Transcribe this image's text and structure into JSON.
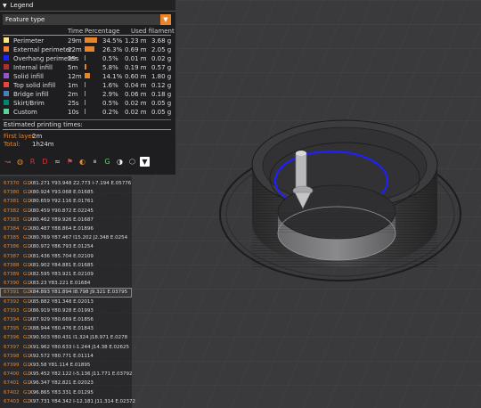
{
  "legend": {
    "header": "Legend",
    "selector_value": "Feature type",
    "columns": {
      "time": "Time",
      "percentage": "Percentage",
      "used_filament": "Used filament"
    },
    "features": [
      {
        "name": "Perimeter",
        "time": "29m",
        "pct": "34.5%",
        "len": "1.23 m",
        "wt": "3.68 g",
        "color": "#ffe680",
        "fraction": 0.345
      },
      {
        "name": "External perimeter",
        "time": "22m",
        "pct": "26.3%",
        "len": "0.69 m",
        "wt": "2.05 g",
        "color": "#ff7d38",
        "fraction": 0.263
      },
      {
        "name": "Overhang perimeter",
        "time": "25s",
        "pct": "0.5%",
        "len": "0.01 m",
        "wt": "0.02 g",
        "color": "#1f1fff",
        "fraction": 0.005
      },
      {
        "name": "Internal infill",
        "time": "5m",
        "pct": "5.8%",
        "len": "0.19 m",
        "wt": "0.57 g",
        "color": "#b03029",
        "fraction": 0.058
      },
      {
        "name": "Solid infill",
        "time": "12m",
        "pct": "14.1%",
        "len": "0.60 m",
        "wt": "1.80 g",
        "color": "#9654cc",
        "fraction": 0.141
      },
      {
        "name": "Top solid infill",
        "time": "1m",
        "pct": "1.6%",
        "len": "0.04 m",
        "wt": "0.12 g",
        "color": "#f04040",
        "fraction": 0.016
      },
      {
        "name": "Bridge infill",
        "time": "2m",
        "pct": "2.9%",
        "len": "0.06 m",
        "wt": "0.18 g",
        "color": "#4d80ba",
        "fraction": 0.029
      },
      {
        "name": "Skirt/Brim",
        "time": "25s",
        "pct": "0.5%",
        "len": "0.02 m",
        "wt": "0.05 g",
        "color": "#00876e",
        "fraction": 0.005
      },
      {
        "name": "Custom",
        "time": "10s",
        "pct": "0.2%",
        "len": "0.02 m",
        "wt": "0.05 g",
        "color": "#5ed194",
        "fraction": 0.002
      }
    ],
    "estimated_title": "Estimated printing times:",
    "first_layer_label": "First layer:",
    "first_layer_value": "2m",
    "total_label": "Total:",
    "total_value": "1h24m"
  },
  "toolbar_icons": [
    "travel-icon",
    "wipe-icon",
    "retractions-icon",
    "deretractions-icon",
    "seams-icon",
    "tool-changes-icon",
    "color-changes-icon",
    "pause-prints-icon",
    "custom-gcode-icon",
    "center-of-gravity-icon",
    "shells-icon",
    "tool-marker-icon"
  ],
  "gcode": {
    "selected_line": "67391",
    "lines": [
      {
        "n": "67370",
        "g": "G1",
        "p": "X81.271 Y93.948 Z2.773 I-7.194 E.05776"
      },
      {
        "n": "67380",
        "g": "G1",
        "p": "X80.924 Y93.068 E.01685"
      },
      {
        "n": "67381",
        "g": "G1",
        "p": "X80.659 Y92.116 E.01761"
      },
      {
        "n": "67382",
        "g": "G1",
        "p": "X80.459 Y90.872 E.02245"
      },
      {
        "n": "67383",
        "g": "G1",
        "p": "X80.462 Y89.926 E.01687"
      },
      {
        "n": "67384",
        "g": "G1",
        "p": "X80.487 Y88.864 E.01896"
      },
      {
        "n": "67385",
        "g": "G2",
        "p": "X80.769 Y87.467 I15.202 J2.348 E.0254"
      },
      {
        "n": "67386",
        "g": "G1",
        "p": "X80.972 Y86.793 E.01254"
      },
      {
        "n": "67387",
        "g": "G1",
        "p": "X81.436 Y85.704 E.02109"
      },
      {
        "n": "67388",
        "g": "G1",
        "p": "X81.902 Y84.881 E.01685"
      },
      {
        "n": "67389",
        "g": "G1",
        "p": "X82.595 Y83.921 E.02109"
      },
      {
        "n": "67390",
        "g": "G1",
        "p": "X83.23 Y83.221 E.01684"
      },
      {
        "n": "67391",
        "g": "G2",
        "p": "X84.893 Y81.894 I8.798 J9.321 E.03795"
      },
      {
        "n": "67392",
        "g": "G1",
        "p": "X85.882 Y81.348 E.02013"
      },
      {
        "n": "67393",
        "g": "G1",
        "p": "X86.919 Y80.928 E.01993"
      },
      {
        "n": "67394",
        "g": "G1",
        "p": "X87.929 Y80.669 E.01856"
      },
      {
        "n": "67395",
        "g": "G1",
        "p": "X88.944 Y80.476 E.01843"
      },
      {
        "n": "67396",
        "g": "G2",
        "p": "X90.503 Y80.431 I1.324 J18.971 E.0278"
      },
      {
        "n": "67397",
        "g": "G2",
        "p": "X91.962 Y80.633 I-1.244 J14.38 E.02625"
      },
      {
        "n": "67398",
        "g": "G1",
        "p": "X92.572 Y80.771 E.01114"
      },
      {
        "n": "67399",
        "g": "G1",
        "p": "X93.58 Y81.114 E.01895"
      },
      {
        "n": "67400",
        "g": "G2",
        "p": "X95.452 Y82.122 I-5.136 J11.771 E.03792"
      },
      {
        "n": "67401",
        "g": "G1",
        "p": "X96.347 Y82.821 E.02023"
      },
      {
        "n": "67402",
        "g": "G1",
        "p": "X96.865 Y83.331 E.01295"
      },
      {
        "n": "67403",
        "g": "G2",
        "p": "X97.731 Y84.342 I-12.181 J11.314 E.02372"
      }
    ]
  }
}
